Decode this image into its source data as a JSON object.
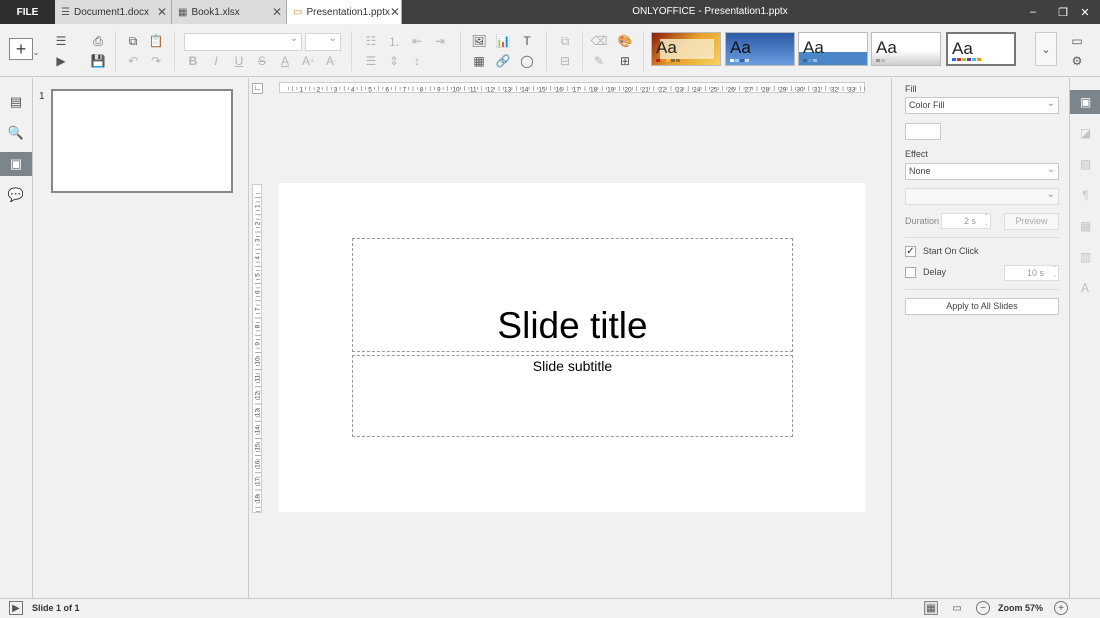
{
  "titlebar": {
    "file_label": "FILE",
    "window_title": "ONLYOFFICE - Presentation1.pptx",
    "tabs": [
      {
        "label": "Document1.docx",
        "icon": "document-icon"
      },
      {
        "label": "Book1.xlsx",
        "icon": "spreadsheet-icon"
      },
      {
        "label": "Presentation1.pptx",
        "icon": "presentation-icon"
      }
    ],
    "active_tab": 2
  },
  "toolbar": {
    "font_name": "",
    "font_size": "",
    "themes": [
      "Aa",
      "Aa",
      "Aa",
      "Aa",
      "Aa"
    ]
  },
  "thumbnails": {
    "slide_number": "1"
  },
  "slide": {
    "title": "Slide title",
    "subtitle": "Slide subtitle"
  },
  "ruler": {
    "h_labels": [
      "1",
      "2",
      "3",
      "4",
      "5",
      "6",
      "7",
      "8",
      "9",
      "10",
      "11",
      "12",
      "13",
      "14",
      "15",
      "16",
      "17",
      "18",
      "19",
      "20",
      "21",
      "22",
      "23",
      "24",
      "25",
      "26",
      "27",
      "28",
      "29",
      "30",
      "31",
      "32",
      "33"
    ],
    "v_labels": [
      "1",
      "2",
      "3",
      "4",
      "5",
      "6",
      "7",
      "8",
      "9",
      "10",
      "11",
      "12",
      "13",
      "14",
      "15",
      "16",
      "17",
      "18"
    ]
  },
  "rightpanel": {
    "fill_label": "Fill",
    "fill_value": "Color Fill",
    "effect_label": "Effect",
    "effect_value": "None",
    "effect_type_value": "",
    "duration_label": "Duration",
    "duration_value": "2 s",
    "preview_label": "Preview",
    "start_on_click_label": "Start On Click",
    "start_on_click_checked": true,
    "delay_label": "Delay",
    "delay_checked": false,
    "delay_value": "10 s",
    "apply_all_label": "Apply to All Slides"
  },
  "statusbar": {
    "slide_info": "Slide 1 of 1",
    "zoom_label": "Zoom 57%"
  },
  "colors": {
    "titlebar_bg": "#404040",
    "active_tab_bg": "#ffffff",
    "inactive_tab_bg": "#dcdcdc",
    "active_sidebar_bg": "#7d858c",
    "panel_bg": "#f1f1f1"
  }
}
